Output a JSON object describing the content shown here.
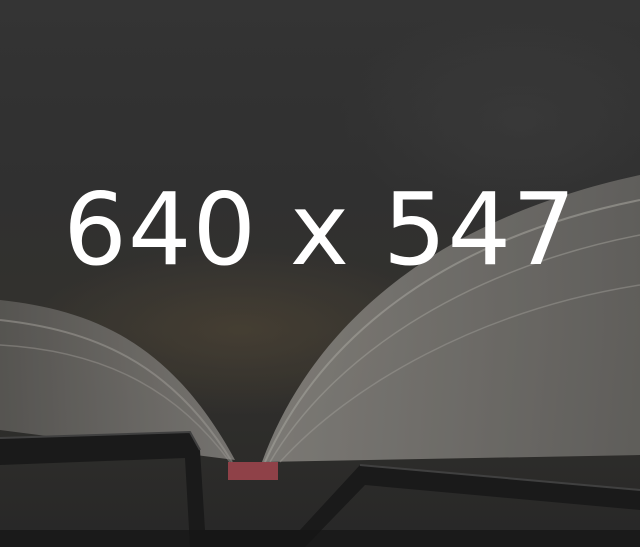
{
  "image": {
    "label": "640 x 547",
    "colors": {
      "text": "#ffffff",
      "background": "#363636",
      "pages": "#8f8c86",
      "cover": "#1c1c1c",
      "ribbon": "#c0505a"
    },
    "icons": [
      "open-book-icon"
    ]
  }
}
